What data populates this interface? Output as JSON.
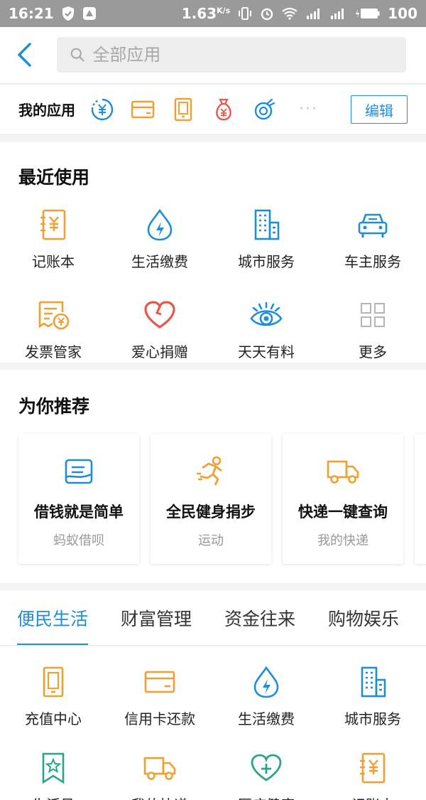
{
  "status_bar": {
    "time": "16:21",
    "speed": "1.63",
    "speed_unit": "K/s",
    "battery": "100"
  },
  "search": {
    "placeholder": "全部应用"
  },
  "my_apps": {
    "title": "我的应用",
    "icons": [
      "yuan-circle-icon",
      "card-icon",
      "tablet-icon",
      "money-bag-icon",
      "dragon-icon"
    ],
    "more": "···",
    "edit_label": "编辑"
  },
  "recent": {
    "title": "最近使用",
    "items": [
      {
        "label": "记账本",
        "icon": "ledger-icon"
      },
      {
        "label": "生活缴费",
        "icon": "water-bolt-icon"
      },
      {
        "label": "城市服务",
        "icon": "building-icon"
      },
      {
        "label": "车主服务",
        "icon": "car-icon"
      },
      {
        "label": "发票管家",
        "icon": "invoice-icon"
      },
      {
        "label": "爱心捐赠",
        "icon": "heart-icon"
      },
      {
        "label": "天天有料",
        "icon": "eye-icon"
      },
      {
        "label": "更多",
        "icon": "grid-more-icon"
      }
    ]
  },
  "recommend": {
    "title": "为你推荐",
    "cards": [
      {
        "title": "借钱就是简单",
        "subtitle": "蚂蚁借呗",
        "icon": "hand-money-icon"
      },
      {
        "title": "全民健身捐步",
        "subtitle": "运动",
        "icon": "runner-icon"
      },
      {
        "title": "快递一键查询",
        "subtitle": "我的快递",
        "icon": "truck-icon"
      }
    ]
  },
  "tabs": [
    "便民生活",
    "财富管理",
    "资金往来",
    "购物娱乐"
  ],
  "category_items": [
    {
      "label": "充值中心",
      "icon": "phone-icon"
    },
    {
      "label": "信用卡还款",
      "icon": "credit-card-icon"
    },
    {
      "label": "生活缴费",
      "icon": "water-bolt-icon"
    },
    {
      "label": "城市服务",
      "icon": "building-icon"
    },
    {
      "label": "生活号",
      "icon": "bookmark-star-icon"
    },
    {
      "label": "我的快递",
      "icon": "truck-icon"
    },
    {
      "label": "医疗健康",
      "icon": "heart-plus-icon"
    },
    {
      "label": "记账本",
      "icon": "ledger-icon"
    }
  ],
  "colors": {
    "accent": "#1e8fd6",
    "orange": "#f0a030",
    "red": "#e8584a",
    "green": "#2aa58a"
  }
}
